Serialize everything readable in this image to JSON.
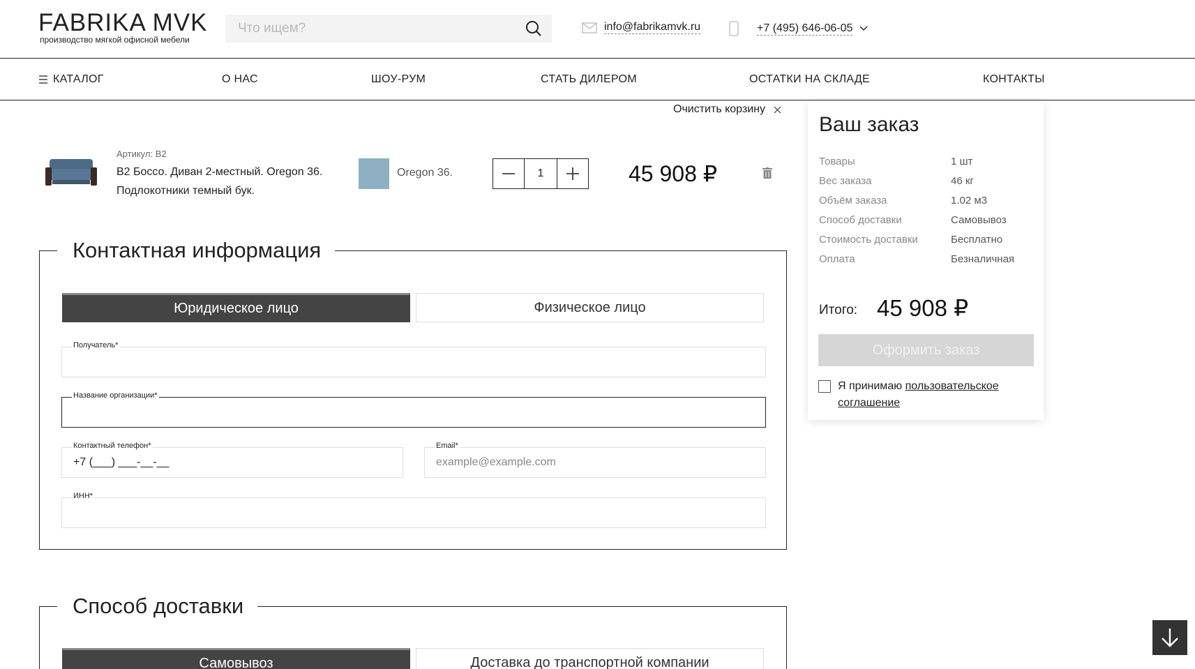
{
  "header": {
    "logo_title": "FABRIKA MVK",
    "logo_subtitle": "производство мягкой офисной мебели",
    "search_placeholder": "Что ищем?",
    "email": "info@fabrikamvk.ru",
    "phone": "+7 (495) 646-06-05"
  },
  "nav": {
    "items": [
      "КАТАЛОГ",
      "О НАС",
      "ШОУ-РУМ",
      "СТАТЬ ДИЛЕРОМ",
      "ОСТАТКИ НА СКЛАДЕ",
      "КОНТАКТЫ"
    ]
  },
  "cart": {
    "clear_label": "Очистить корзину",
    "item": {
      "article": "Артикул: В2",
      "name": "В2 Боссо. Диван 2-местный. Oregon 36. Подлокотники темный бук.",
      "color_label": "Oregon 36.",
      "color_hex": "#8fb0c2",
      "quantity": "1",
      "price": "45 908 ₽"
    }
  },
  "contact_section": {
    "title": "Контактная информация",
    "tabs": [
      "Юридическое лицо",
      "Физическое лицо"
    ],
    "active_tab": "Юридическое лицо",
    "fields": {
      "recipient_label": "Получатель*",
      "org_label": "Название организации*",
      "phone_label": "Контактный телефон*",
      "phone_value": "+7 (___) ___-__-__",
      "email_label": "Email*",
      "email_placeholder": "example@example.com",
      "inn_label": "ИНН*"
    }
  },
  "delivery_section": {
    "title": "Способ доставки",
    "tabs": [
      "Самовывоз",
      "Доставка до транспортной компании"
    ]
  },
  "summary": {
    "title": "Ваш заказ",
    "rows": [
      {
        "key": "Товары",
        "value": "1 шт"
      },
      {
        "key": "Вес заказа",
        "value": "46 кг"
      },
      {
        "key": "Объём заказа",
        "value": "1.02 м3"
      },
      {
        "key": "Способ доставки",
        "value": "Самовывоз"
      },
      {
        "key": "Стоимость доставки",
        "value": "Бесплатно"
      },
      {
        "key": "Оплата",
        "value": "Безналичная"
      }
    ],
    "total_label": "Итого:",
    "total_value": "45 908 ₽",
    "order_button": "Оформить заказ",
    "agree_prefix": "Я принимаю ",
    "agree_link": "пользовательское соглашение"
  },
  "colors": {
    "accent_dark": "#444444",
    "button_disabled": "#d6d6d6"
  }
}
